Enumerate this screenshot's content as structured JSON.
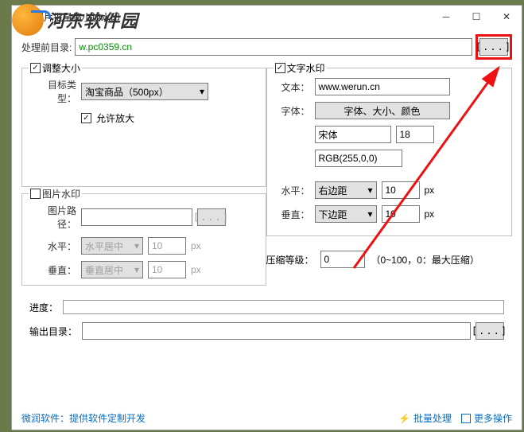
{
  "window": {
    "title": "图片批量缩小加水印"
  },
  "watermark_text": "河东软件园",
  "input_dir": {
    "label": "处理前目录:",
    "value": "w.pc0359.cn",
    "browse": "[...]"
  },
  "resize": {
    "legend": "调整大小",
    "target_type_label": "目标类型：",
    "target_type_value": "淘宝商品（500px）",
    "allow_enlarge": "允许放大"
  },
  "image_wm": {
    "legend": "图片水印",
    "path_label": "图片路径：",
    "path_value": "",
    "browse": "[...]",
    "h_label": "水平：",
    "h_sel": "水平居中",
    "h_val": "10",
    "h_unit": "px",
    "v_label": "垂直：",
    "v_sel": "垂直居中",
    "v_val": "10",
    "v_unit": "px"
  },
  "text_wm": {
    "legend": "文字水印",
    "text_label": "文本：",
    "text_value": "www.werun.cn",
    "font_label": "字体：",
    "font_btn": "字体、大小、颜色",
    "font_name": "宋体",
    "font_size": "18",
    "font_color": "RGB(255,0,0)",
    "h_label": "水平：",
    "h_sel": "右边距",
    "h_val": "10",
    "h_unit": "px",
    "v_label": "垂直：",
    "v_sel": "下边距",
    "v_val": "10",
    "v_unit": "px"
  },
  "compress": {
    "label": "压缩等级：",
    "value": "0",
    "hint": "（0~100，0：最大压缩）"
  },
  "progress": {
    "label": "进度："
  },
  "output": {
    "label": "输出目录：",
    "value": "",
    "browse": "[...]"
  },
  "footer": {
    "link": "微润软件：提供软件定制开发",
    "batch": "批量处理",
    "more": "更多操作"
  }
}
